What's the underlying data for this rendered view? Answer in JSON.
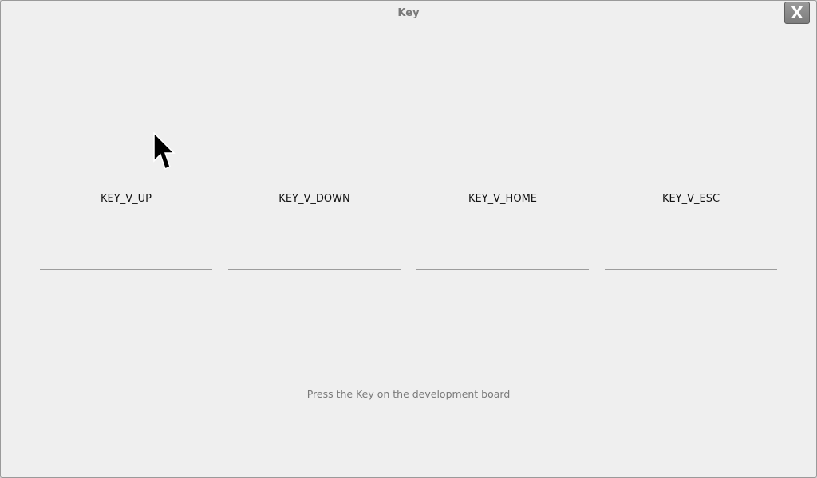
{
  "window": {
    "title": "Key",
    "close_label": "X"
  },
  "keys": [
    {
      "label": "KEY_V_UP"
    },
    {
      "label": "KEY_V_DOWN"
    },
    {
      "label": "KEY_V_HOME"
    },
    {
      "label": "KEY_V_ESC"
    }
  ],
  "hint": "Press the Key on the development board",
  "icons": {
    "cursor": "mouse-pointer-icon",
    "close": "close-icon"
  }
}
